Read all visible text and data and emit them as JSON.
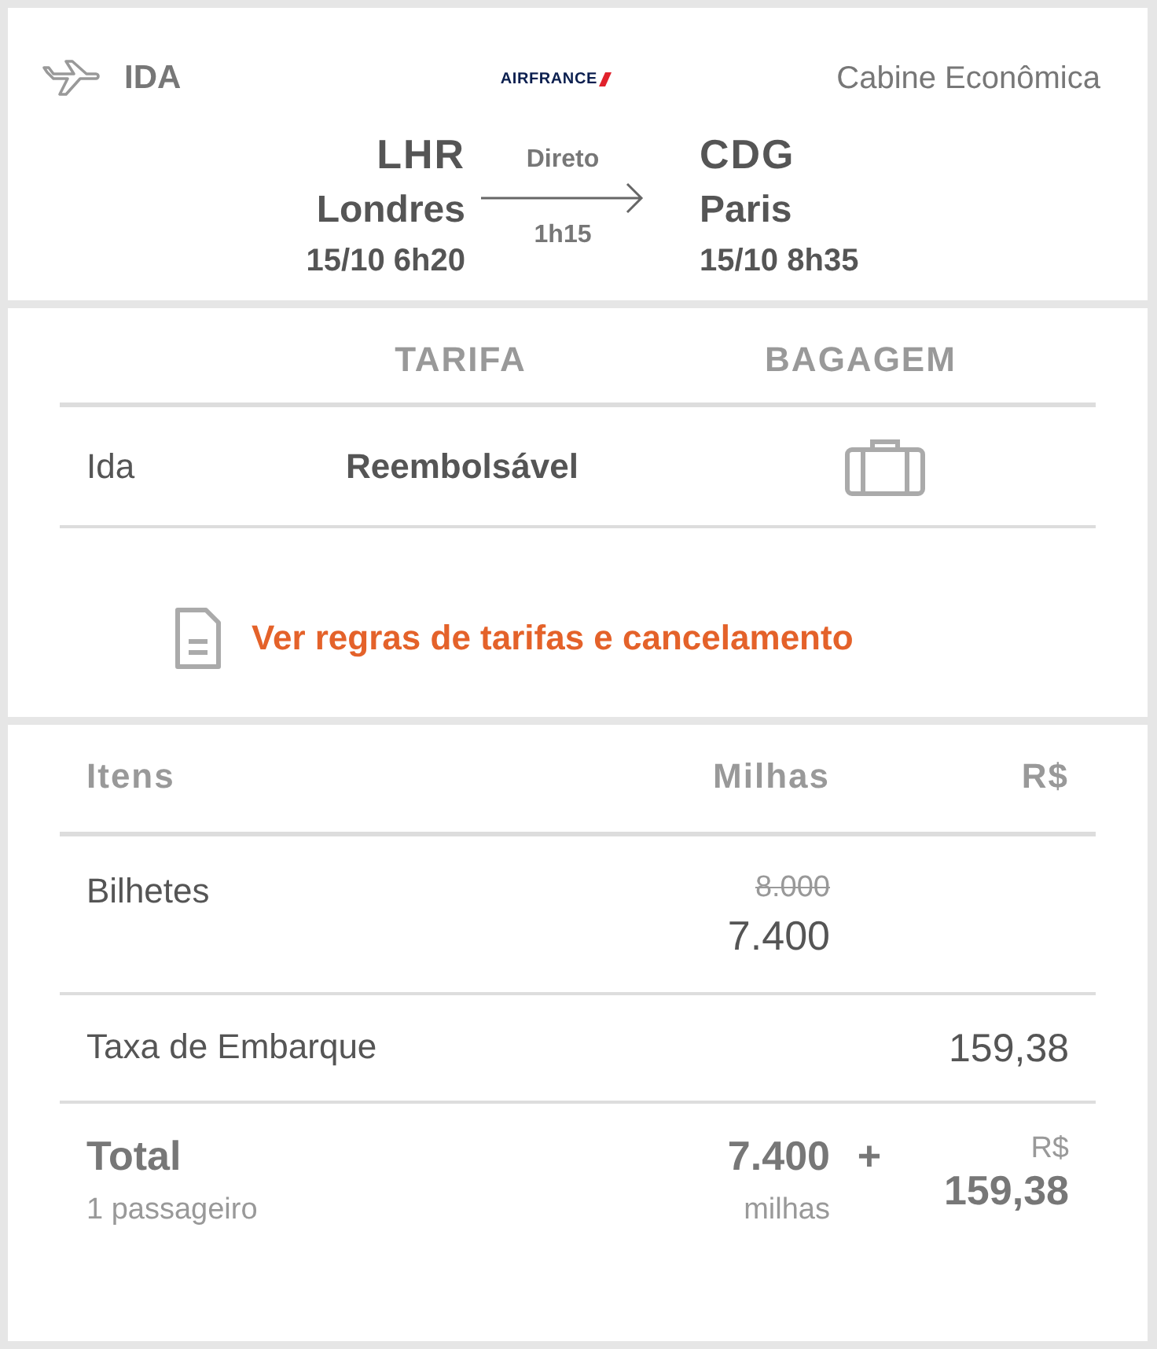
{
  "flight": {
    "direction": "IDA",
    "airline": "AIRFRANCE",
    "cabin": "Cabine Econômica",
    "origin": {
      "code": "LHR",
      "city": "Londres",
      "time": "15/10 6h20"
    },
    "stop_type": "Direto",
    "duration": "1h15",
    "destination": {
      "code": "CDG",
      "city": "Paris",
      "time": "15/10 8h35"
    }
  },
  "fare": {
    "columns": [
      "TARIFA",
      "BAGAGEM"
    ],
    "rows": [
      {
        "leg": "Ida",
        "fare": "Reembolsável"
      }
    ],
    "rules_link": "Ver regras de tarifas e cancelamento"
  },
  "price": {
    "columns": [
      "Itens",
      "Milhas",
      "R$"
    ],
    "rows": [
      {
        "item": "Bilhetes",
        "old_miles": "8.000",
        "miles": "7.400",
        "reais": ""
      },
      {
        "item": "Taxa de Embarque",
        "miles": "",
        "reais": "159,38"
      }
    ],
    "total": {
      "label": "Total",
      "passengers": "1 passageiro",
      "miles": "7.400",
      "miles_unit": "milhas",
      "plus": "+",
      "currency": "R$",
      "reais": "159,38"
    }
  }
}
